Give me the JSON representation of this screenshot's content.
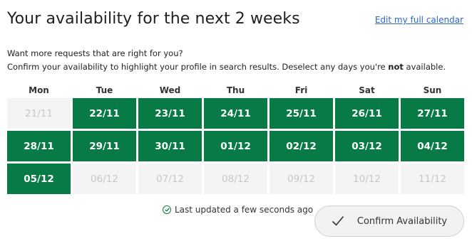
{
  "header": {
    "title": "Your availability for the next 2 weeks",
    "edit_link": "Edit my full calendar"
  },
  "intro": {
    "line1": "Want more requests that are right for you?",
    "line2_before": "Confirm your availability to highlight your profile in search results. Deselect any days you're ",
    "line2_bold": "not",
    "line2_after": " available."
  },
  "calendar": {
    "days": [
      "Mon",
      "Tue",
      "Wed",
      "Thu",
      "Fri",
      "Sat",
      "Sun"
    ],
    "dates": [
      {
        "label": "21/11",
        "available": false
      },
      {
        "label": "22/11",
        "available": true
      },
      {
        "label": "23/11",
        "available": true
      },
      {
        "label": "24/11",
        "available": true
      },
      {
        "label": "25/11",
        "available": true
      },
      {
        "label": "26/11",
        "available": true
      },
      {
        "label": "27/11",
        "available": true
      },
      {
        "label": "28/11",
        "available": true
      },
      {
        "label": "29/11",
        "available": true
      },
      {
        "label": "30/11",
        "available": true
      },
      {
        "label": "01/12",
        "available": true
      },
      {
        "label": "02/12",
        "available": true
      },
      {
        "label": "03/12",
        "available": true
      },
      {
        "label": "04/12",
        "available": true
      },
      {
        "label": "05/12",
        "available": true
      },
      {
        "label": "06/12",
        "available": false
      },
      {
        "label": "07/12",
        "available": false
      },
      {
        "label": "08/12",
        "available": false
      },
      {
        "label": "09/12",
        "available": false
      },
      {
        "label": "10/12",
        "available": false
      },
      {
        "label": "11/12",
        "available": false
      }
    ]
  },
  "footer": {
    "status_text": "Last updated a few seconds ago",
    "status_icon": "check-circle-icon",
    "confirm_label": "Confirm Availability",
    "confirm_icon": "checkmark-icon"
  },
  "colors": {
    "available": "#087a45",
    "unavailable": "#f4f4f4",
    "link": "#2a67c9"
  }
}
